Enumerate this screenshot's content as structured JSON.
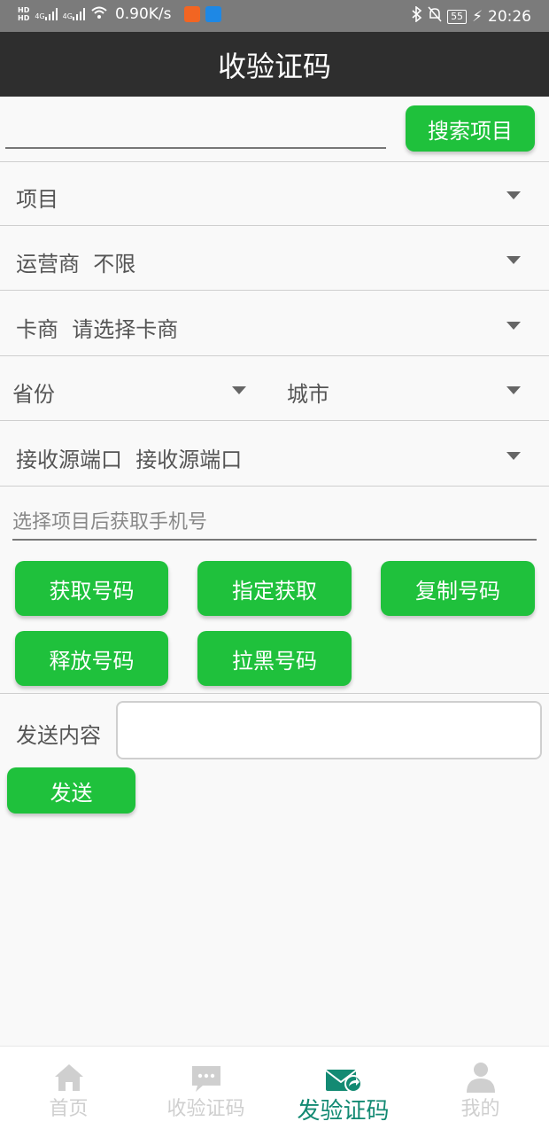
{
  "status_bar": {
    "hd1": "HD",
    "hd2": "HD",
    "net1": "4G",
    "net2": "4G",
    "speed": "0.90K/s",
    "battery": "55",
    "time": "20:26"
  },
  "header": {
    "title": "收验证码"
  },
  "search": {
    "placeholder": "",
    "button": "搜索项目"
  },
  "selectors": {
    "project": "项目",
    "operator_label": "运营商",
    "operator_value": "不限",
    "card_label": "卡商",
    "card_value": "请选择卡商",
    "province": "省份",
    "city": "城市",
    "port_label": "接收源端口",
    "port_value": "接收源端口"
  },
  "phone": {
    "placeholder": "选择项目后获取手机号"
  },
  "actions": {
    "get_number": "获取号码",
    "specify_get": "指定获取",
    "copy_number": "复制号码",
    "release_number": "释放号码",
    "block_number": "拉黑号码"
  },
  "send": {
    "label": "发送内容",
    "button": "发送"
  },
  "tabs": [
    {
      "label": "首页",
      "icon": "home-icon"
    },
    {
      "label": "收验证码",
      "icon": "message-icon"
    },
    {
      "label": "发验证码",
      "icon": "send-mail-icon"
    },
    {
      "label": "我的",
      "icon": "user-icon"
    }
  ],
  "colors": {
    "accent": "#1fc13c",
    "header": "#2e2e2e",
    "active_tab": "#138a73"
  }
}
